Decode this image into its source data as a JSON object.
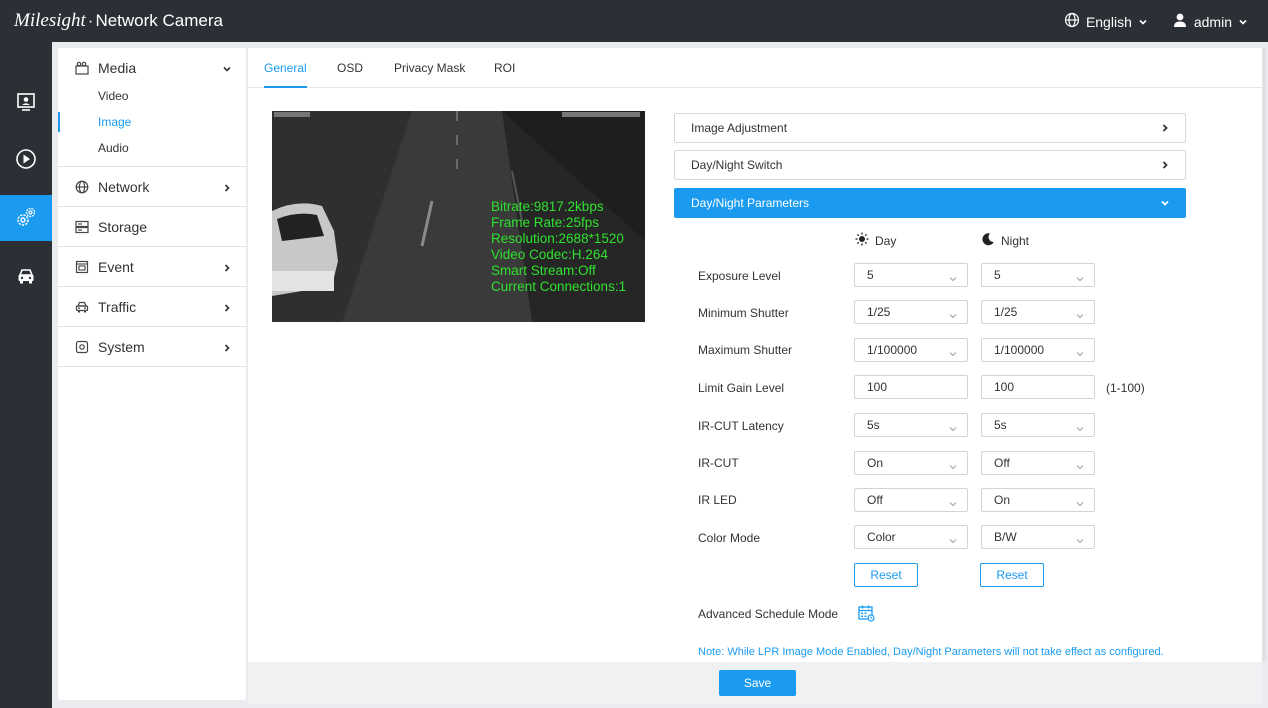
{
  "header": {
    "brand_logo": "Milesight",
    "brand_sep": "·",
    "brand_product": "Network Camera",
    "language": "English",
    "user": "admin"
  },
  "iconbar": [
    {
      "icon": "live-view-icon"
    },
    {
      "icon": "playback-icon"
    },
    {
      "icon": "settings-icon",
      "active": true
    },
    {
      "icon": "vehicle-icon"
    }
  ],
  "sidebar": {
    "media": {
      "label": "Media",
      "items": [
        {
          "label": "Video"
        },
        {
          "label": "Image",
          "active": true
        },
        {
          "label": "Audio"
        }
      ]
    },
    "network": {
      "label": "Network"
    },
    "storage": {
      "label": "Storage"
    },
    "event": {
      "label": "Event"
    },
    "traffic": {
      "label": "Traffic"
    },
    "system": {
      "label": "System"
    }
  },
  "tabs": [
    {
      "label": "General",
      "active": true
    },
    {
      "label": "OSD"
    },
    {
      "label": "Privacy Mask"
    },
    {
      "label": "ROI"
    }
  ],
  "preview": {
    "osd_lines": [
      "Bitrate:9817.2kbps",
      "Frame Rate:25fps",
      "Resolution:2688*1520",
      "Video Codec:H.264",
      "Smart Stream:Off",
      "Current Connections:1"
    ]
  },
  "accordion": {
    "image_adjustment": "Image Adjustment",
    "day_night_switch": "Day/Night Switch",
    "day_night_params": "Day/Night Parameters"
  },
  "columns": {
    "day": "Day",
    "night": "Night"
  },
  "params": {
    "exposure": {
      "label": "Exposure Level",
      "day": "5",
      "night": "5"
    },
    "min_shutter": {
      "label": "Minimum Shutter",
      "day": "1/25",
      "night": "1/25"
    },
    "max_shutter": {
      "label": "Maximum Shutter",
      "day": "1/100000",
      "night": "1/100000"
    },
    "gain": {
      "label": "Limit Gain Level",
      "day": "100",
      "night": "100",
      "range": "(1-100)"
    },
    "ircut_latency": {
      "label": "IR-CUT Latency",
      "day": "5s",
      "night": "5s"
    },
    "ircut": {
      "label": "IR-CUT",
      "day": "On",
      "night": "Off"
    },
    "irled": {
      "label": "IR LED",
      "day": "Off",
      "night": "On"
    },
    "color_mode": {
      "label": "Color Mode",
      "day": "Color",
      "night": "B/W"
    }
  },
  "reset_label": "Reset",
  "schedule_label": "Advanced Schedule Mode",
  "note": "Note: While LPR Image Mode Enabled, Day/Night Parameters will not take effect as configured.",
  "save_label": "Save",
  "colors": {
    "accent": "#1a9bf0",
    "topbar": "#2b3036",
    "osd_green": "#2fe02f"
  }
}
